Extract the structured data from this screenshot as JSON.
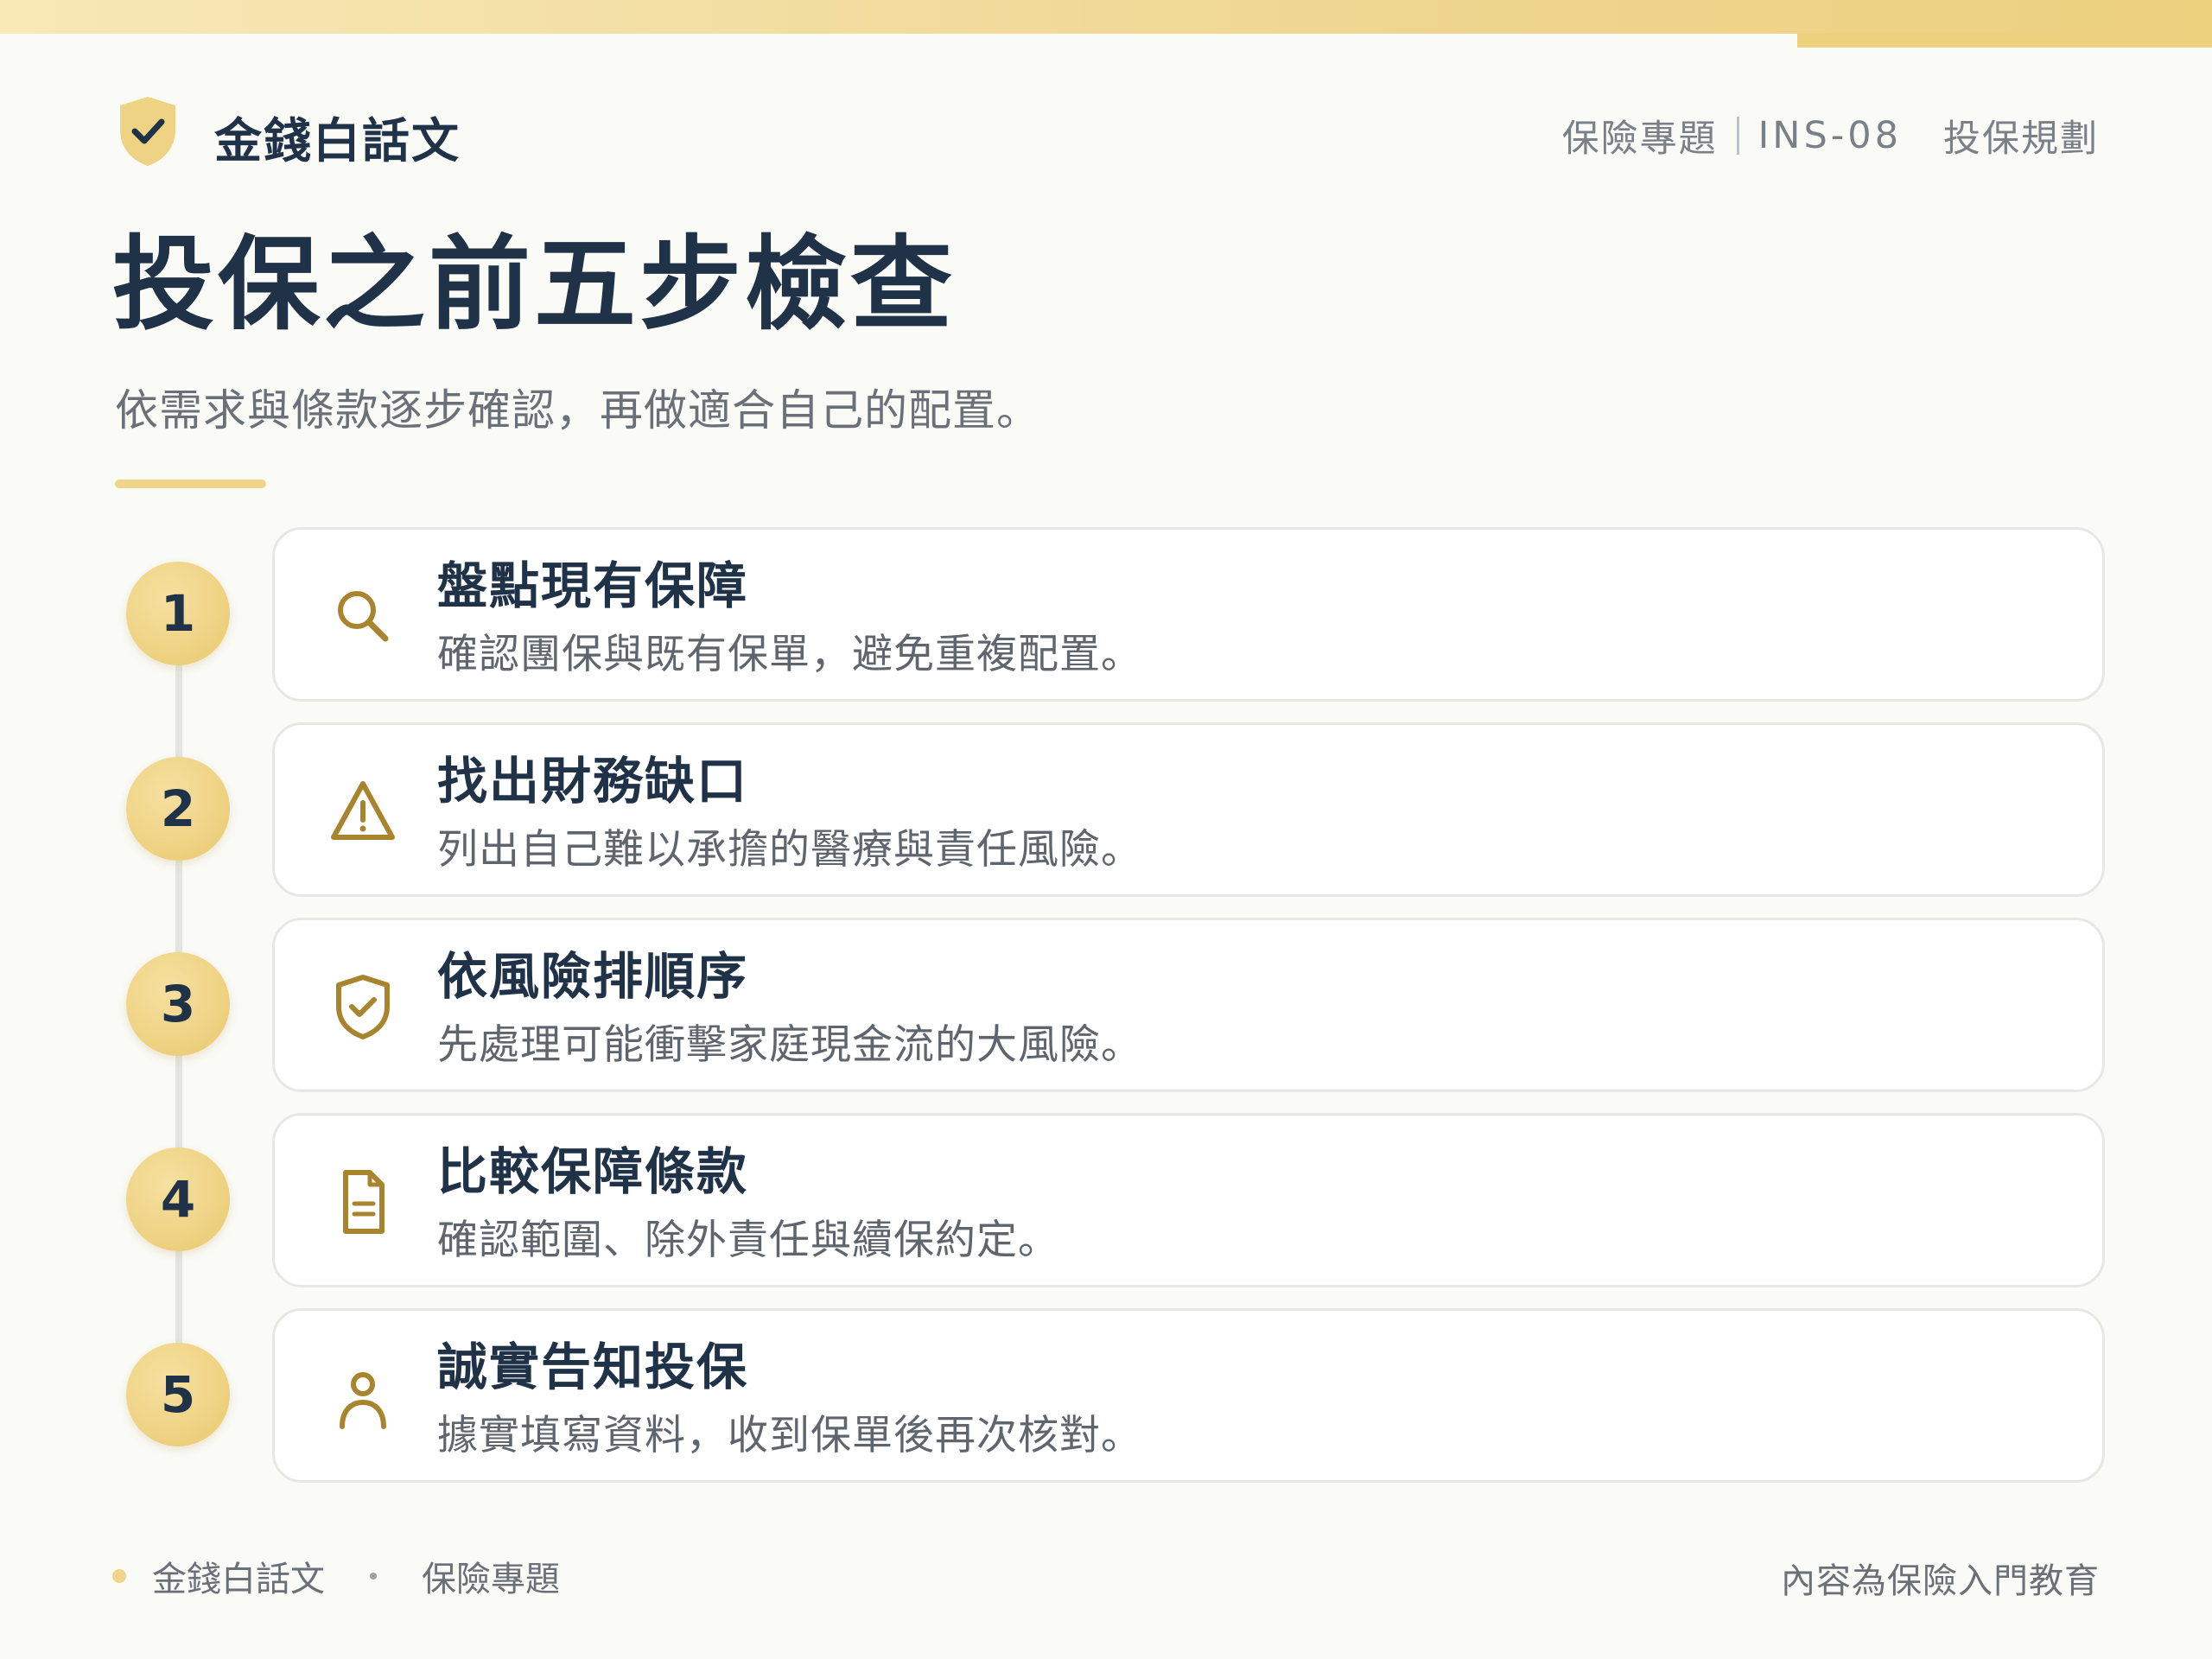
{
  "brand": {
    "name": "金錢白話文",
    "logo_icon": "shield-check-icon"
  },
  "topnav": {
    "topic": "保險專題",
    "code": "INS-08",
    "category": "投保規劃"
  },
  "title": "投保之前五步檢查",
  "subtitle": "依需求與條款逐步確認，再做適合自己的配置。",
  "steps": [
    {
      "number": "1",
      "title": "盤點現有保障",
      "desc": "確認團保與既有保單，避免重複配置。",
      "icon": "search-icon"
    },
    {
      "number": "2",
      "title": "找出財務缺口",
      "desc": "列出自己難以承擔的醫療與責任風險。",
      "icon": "warning-icon"
    },
    {
      "number": "3",
      "title": "依風險排順序",
      "desc": "先處理可能衝擊家庭現金流的大風險。",
      "icon": "shield-check-icon"
    },
    {
      "number": "4",
      "title": "比較保障條款",
      "desc": "確認範圍、除外責任與續保約定。",
      "icon": "document-icon"
    },
    {
      "number": "5",
      "title": "誠實告知投保",
      "desc": "據實填寫資料，收到保單後再次核對。",
      "icon": "person-icon"
    }
  ],
  "footer": {
    "brand": "金錢白話文",
    "topic": "保險專題",
    "note": "內容為保險入門教育"
  },
  "colors": {
    "accent": "#efd384",
    "icon": "#a8842e",
    "text": "#1f3247"
  }
}
